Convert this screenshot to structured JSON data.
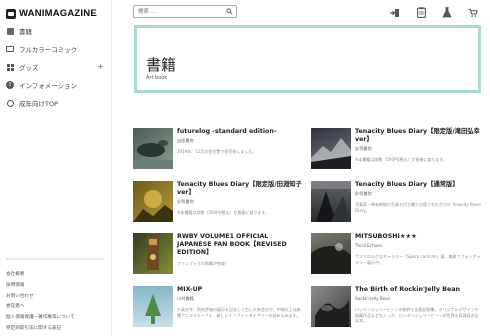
{
  "brand": {
    "name": "WANIMAGAZINE"
  },
  "sidebar": {
    "items": [
      {
        "label": "書籍",
        "icon": "book-icon"
      },
      {
        "label": "フルカラーコミック",
        "icon": "comic-icon"
      },
      {
        "label": "グッズ",
        "icon": "grid-icon",
        "expand": "+"
      },
      {
        "label": "インフォメーション",
        "icon": "info-icon"
      },
      {
        "label": "成年向けTOP",
        "icon": "adult-icon"
      }
    ],
    "footer_links": [
      "会社概要",
      "採用情報",
      "お問い合わせ",
      "委託者へ",
      "個人情報保護・著作権等について",
      "特定商取引法に関する表記"
    ]
  },
  "header": {
    "search_placeholder": "検索 ...",
    "icons": [
      "login-icon",
      "clipboard-icon",
      "flask-icon",
      "cart-icon"
    ]
  },
  "banner": {
    "title": "書籍",
    "subtitle": "Art book"
  },
  "products": [
    {
      "title": "futurelog -standard edition-",
      "publisher": "出版書房",
      "desc": "2019年、12月の初位置で発売致しました。",
      "thumb_colors": [
        "#4b5a55",
        "#8a9b8e"
      ]
    },
    {
      "title": "Tenacity Blues Diary【限定版/滝田弘幸ver】",
      "publisher": "針等書院",
      "desc": "※本書籍は部数（500円/税込）が直接に渡ります。",
      "thumb_colors": [
        "#31343a",
        "#777d82"
      ]
    },
    {
      "title": "Tenacity Blues Diary【限定版/田淵知子ver】",
      "publisher": "針等書院",
      "desc": "※本書籍は部数（500円/税込）が直接に渡ります。",
      "thumb_colors": [
        "#6b5a1e",
        "#b69a3a"
      ]
    },
    {
      "title": "Tenacity Blues Diary【通常版】",
      "publisher": "針等書院",
      "desc": "写真家・希有希物の写真を切り撮り出版されたボクの Tenacity Blues Diary。",
      "thumb_colors": [
        "#282a2d",
        "#616468"
      ]
    },
    {
      "title": "RWBY VOLUME1 OFFICIAL JAPANESE FAN BOOK【REVISED EDITION】",
      "publisher": "",
      "desc": "ファンブックの再構が完成！",
      "thumb_colors": [
        "#2f3b22",
        "#8a8d3a"
      ]
    },
    {
      "title": "MITSUBOSHI★★★",
      "publisher": "Third Echoes",
      "desc": "ウズマの小さなギャラリー「Space caricum」展、美術でフォトギャラリー展示中。",
      "thumb_colors": [
        "#33332f",
        "#7b7a72"
      ]
    },
    {
      "title": "MIX-UP",
      "publisher": "川村書籍",
      "desc": "大真在年、所在評価の展示を記念して古い大有会分か、中城以上は新聞アニマルテーブル、新しいインプットダイアリーの詰め込みます。",
      "thumb_colors": [
        "#88b7c9",
        "#4f8b4a"
      ]
    },
    {
      "title": "The Birth of Rockin'Jelly Bean",
      "publisher": "Rockin'Jelly Bean",
      "desc": "ロッキンジェリービーンの制作と出版記録集、オリジナルデザインや秘蔵作品なども入った、ロッキンジェリービーンの世界を再発見の記念本。",
      "thumb_colors": [
        "#3a3b3d",
        "#8e8e8c"
      ]
    }
  ]
}
